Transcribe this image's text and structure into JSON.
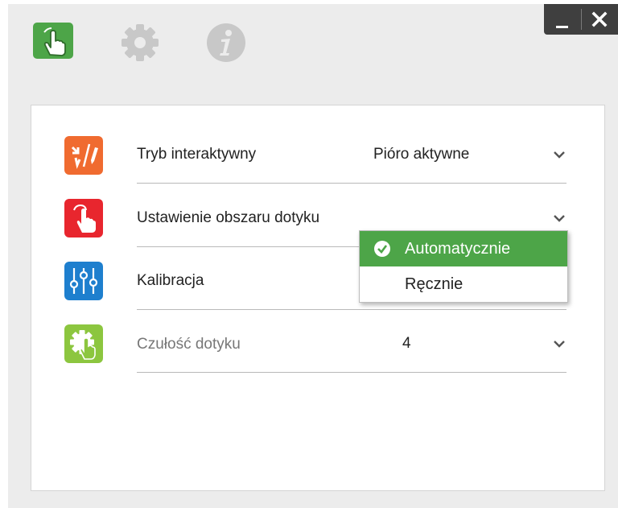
{
  "tabs": [
    {
      "name": "touch-tab",
      "icon": "hand-touch-icon",
      "active": true,
      "color": "#4da548"
    },
    {
      "name": "settings-tab",
      "icon": "gear-icon",
      "active": false,
      "color": "#c8c8c8"
    },
    {
      "name": "info-tab",
      "icon": "info-icon",
      "active": false,
      "color": "#c8c8c8"
    }
  ],
  "window_controls": {
    "minimize_icon": "minimize-icon",
    "close_icon": "close-icon"
  },
  "settings": {
    "rows": [
      {
        "label": "Tryb interaktywny",
        "value": "Pióro aktywne",
        "icon": "pen-touch-icon",
        "icon_color": "#f06b30"
      },
      {
        "label": "Ustawienie obszaru dotyku",
        "value": "",
        "icon": "touch-area-icon",
        "icon_color": "#e8262e"
      },
      {
        "label": "Kalibracja",
        "value": "",
        "icon": "sliders-icon",
        "icon_color": "#1e7fce"
      },
      {
        "label": "Czułość dotyku",
        "value": "4",
        "icon": "gear-touch-icon",
        "icon_color": "#8cc63f"
      }
    ]
  },
  "dropdown": {
    "options": [
      {
        "label": "Automatycznie",
        "selected": true
      },
      {
        "label": "Ręcznie",
        "selected": false
      }
    ],
    "selected_color": "#4da548"
  }
}
